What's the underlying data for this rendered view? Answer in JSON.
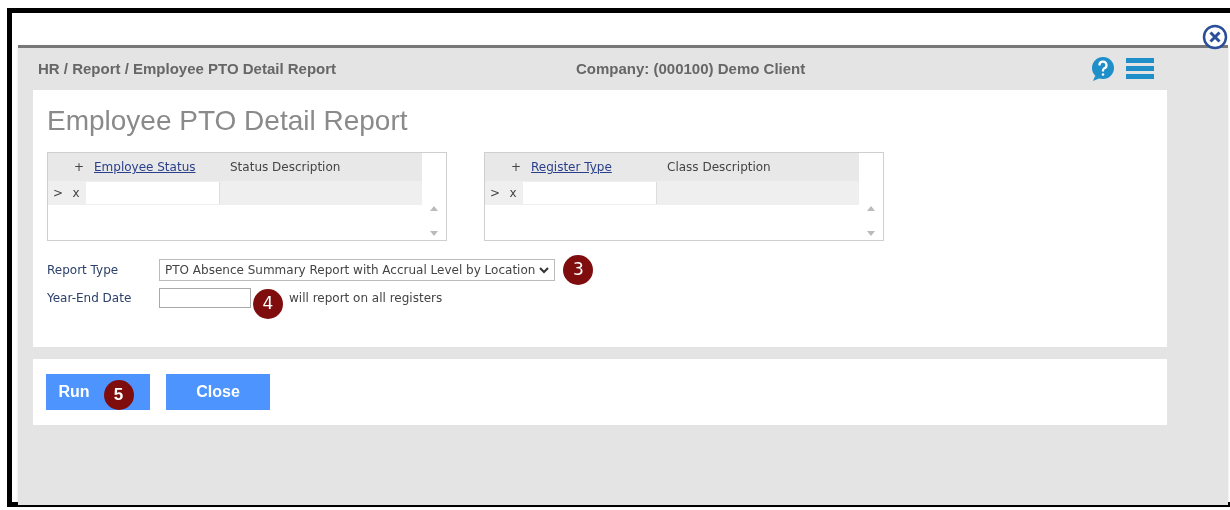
{
  "breadcrumb": "HR / Report / Employee PTO Detail Report",
  "company": "Company: (000100) Demo Client",
  "title": "Employee PTO Detail Report",
  "grids": [
    {
      "add": "+",
      "column_1": "Employee Status",
      "column_2": "Status Description",
      "row_marker": ">",
      "remove": "x"
    },
    {
      "add": "+",
      "column_1": "Register Type",
      "column_2": "Class Description",
      "row_marker": ">",
      "remove": "x"
    }
  ],
  "report_type": {
    "label": "Report Type",
    "value": "PTO Absence Summary Report with Accrual Level by Location",
    "badge": "3"
  },
  "year_end_date": {
    "label": "Year-End Date",
    "badge": "4",
    "note": "will report on all registers"
  },
  "buttons": [
    {
      "label": "Run",
      "badge": "5"
    },
    {
      "label": "Close"
    }
  ]
}
